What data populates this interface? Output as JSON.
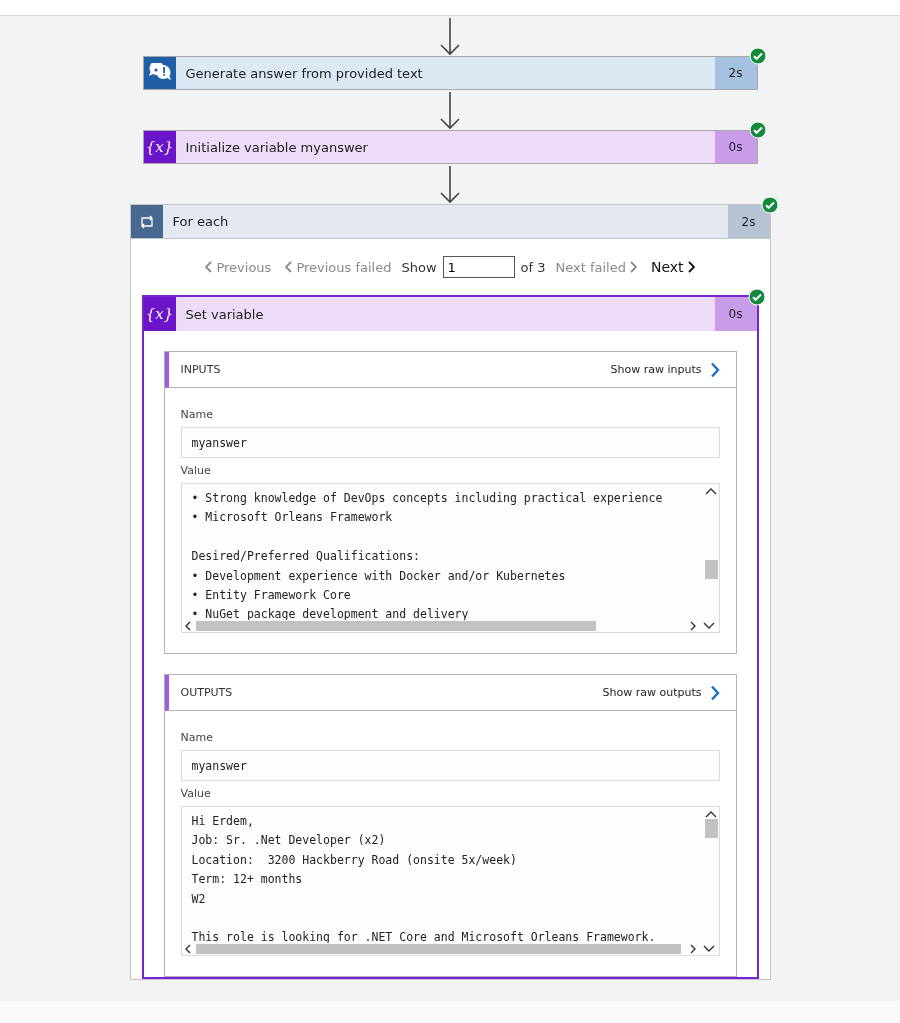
{
  "steps": [
    {
      "kind": "qna",
      "title": "Generate answer from provided text",
      "duration": "2s",
      "succeeded": true
    },
    {
      "kind": "variable",
      "icon_text": "{x}",
      "title": "Initialize variable myanswer",
      "duration": "0s",
      "succeeded": true
    }
  ],
  "foreach": {
    "kind": "loop",
    "title": "For each",
    "duration": "2s",
    "succeeded": true,
    "pager": {
      "previous": {
        "label": "Previous",
        "disabled": true
      },
      "previous_failed": {
        "label": "Previous failed",
        "disabled": true
      },
      "show_label": "Show",
      "index": "1",
      "of": "of 3",
      "next_failed": {
        "label": "Next failed",
        "disabled": true
      },
      "next": {
        "label": "Next",
        "disabled": false
      }
    },
    "action": {
      "kind": "variable",
      "icon_text": "{x}",
      "title": "Set variable",
      "duration": "0s",
      "succeeded": true,
      "sections": [
        {
          "title": "INPUTS",
          "raw_link": "Show raw inputs",
          "name_label": "Name",
          "name_value": "myanswer",
          "value_label": "Value",
          "value_paragraphs": [
            [
              "• Strong knowledge of DevOps concepts including practical experience",
              "• Microsoft Orleans Framework"
            ],
            [
              "Desired/Preferred Qualifications:",
              "• Development experience with Docker and/or Kubernetes",
              "• Entity Framework Core",
              "• NuGet package development and delivery"
            ]
          ]
        },
        {
          "title": "OUTPUTS",
          "raw_link": "Show raw outputs",
          "name_label": "Name",
          "name_value": "myanswer",
          "value_label": "Value",
          "value_paragraphs": [
            [
              "Hi Erdem,",
              "Job: Sr. .Net Developer (x2)",
              "Location:  3200 Hackberry Road (onsite 5x/week)",
              "Term: 12+ months",
              "W2"
            ],
            [
              "This role is looking for .NET Core and Microsoft Orleans Framework."
            ]
          ]
        }
      ]
    }
  }
}
